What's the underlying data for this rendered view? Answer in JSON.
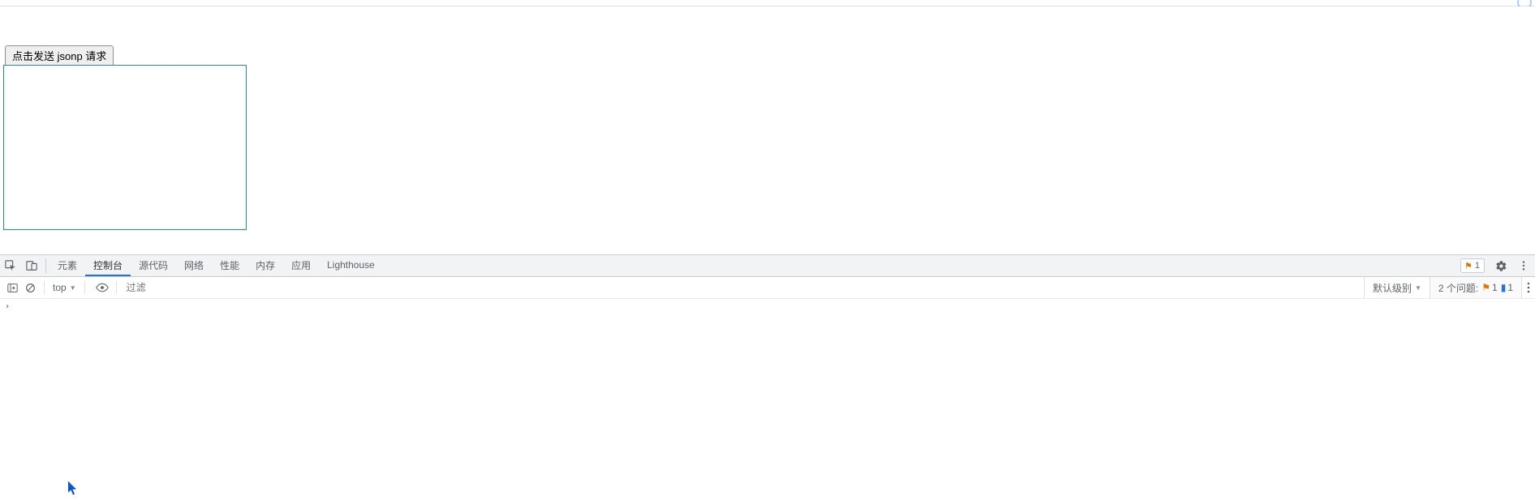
{
  "page": {
    "button_label": "点击发送 jsonp 请求"
  },
  "devtools": {
    "tabs": {
      "elements": "元素",
      "console": "控制台",
      "sources": "源代码",
      "network": "网络",
      "performance": "性能",
      "memory": "内存",
      "application": "应用",
      "lighthouse": "Lighthouse"
    },
    "warning_badge_count": "1"
  },
  "console": {
    "context_label": "top",
    "filter_placeholder": "过滤",
    "level_label": "默认级别",
    "issues_label": "2 个问题:",
    "issues_warn_count": "1",
    "issues_info_count": "1",
    "prompt_symbol": "›"
  }
}
